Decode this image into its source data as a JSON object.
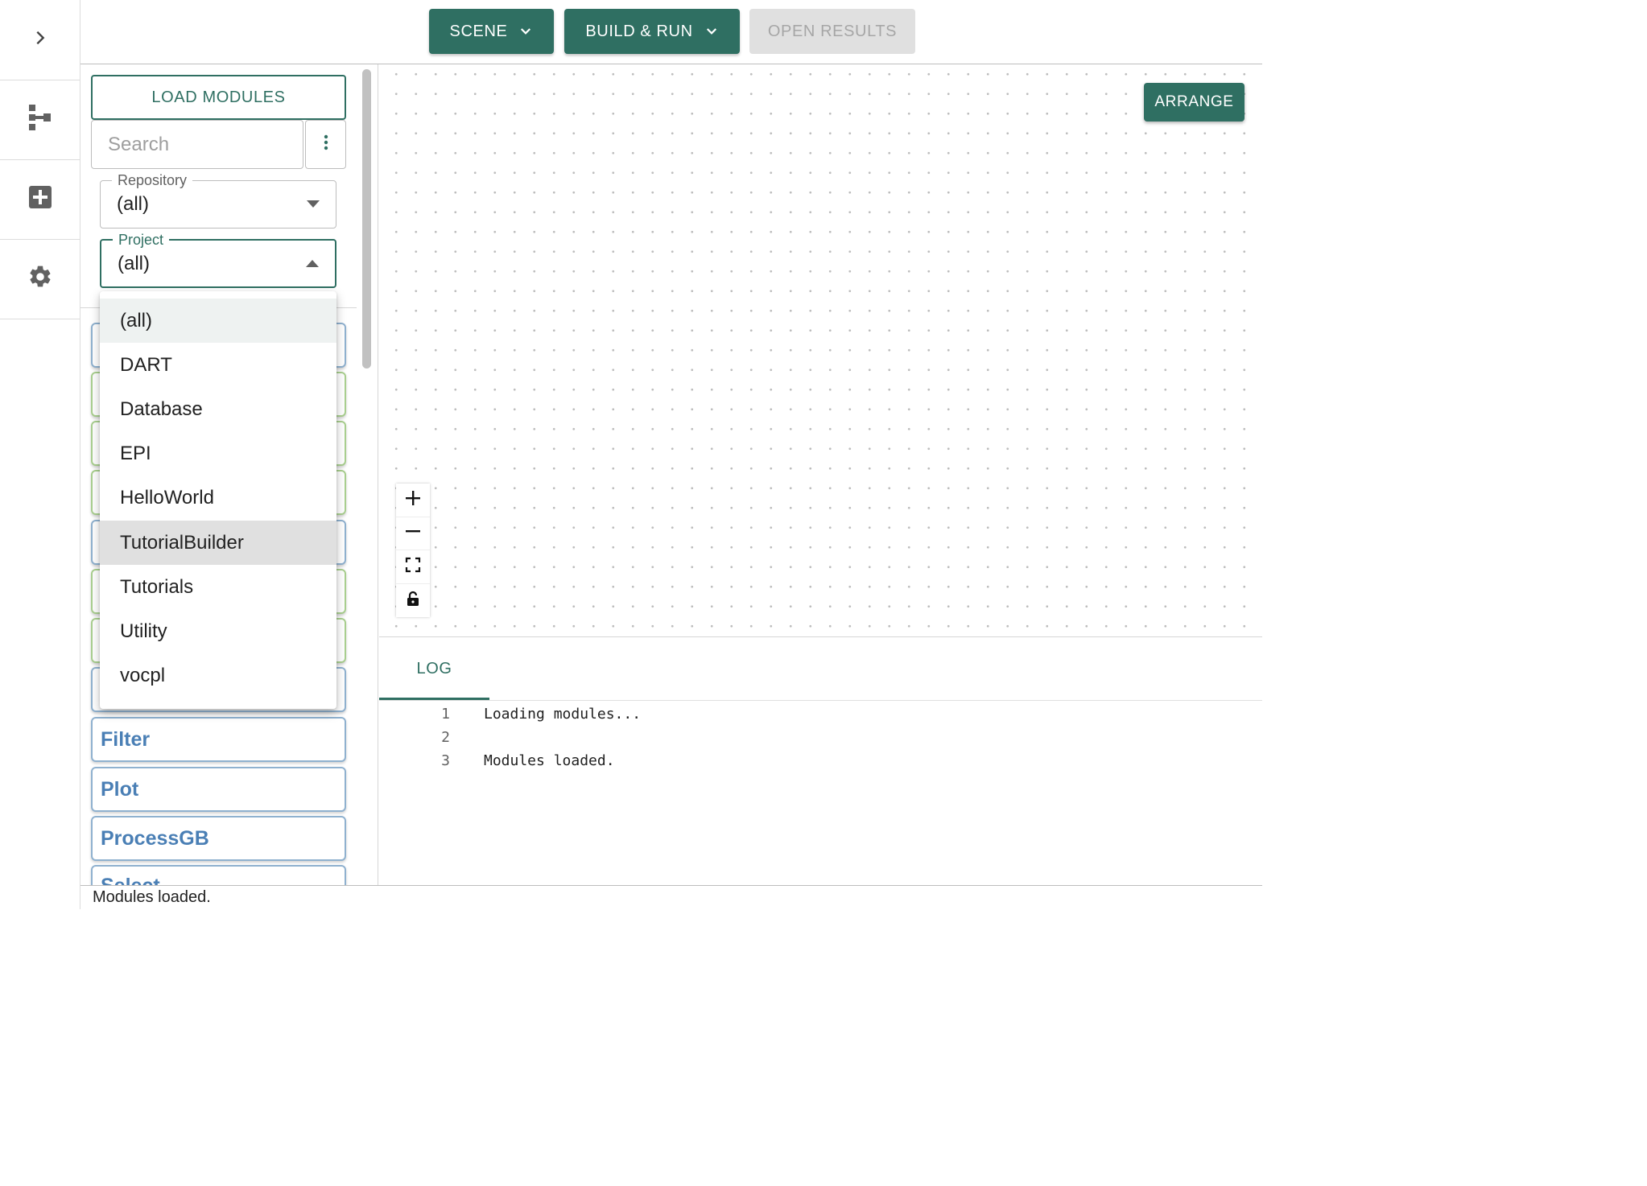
{
  "rail": {
    "icons": [
      "chevron-right-icon",
      "tree-structure-icon",
      "add-box-icon",
      "gear-icon"
    ]
  },
  "toolbar": {
    "scene_label": "SCENE",
    "build_run_label": "BUILD & RUN",
    "open_results_label": "OPEN RESULTS"
  },
  "modules_panel": {
    "load_modules_label": "LOAD MODULES",
    "search": {
      "placeholder": "Search",
      "value": ""
    },
    "repository": {
      "label": "Repository",
      "value": "(all)"
    },
    "project": {
      "label": "Project",
      "value": "(all)",
      "open": true
    },
    "visible_modules": [
      "Filter",
      "Plot",
      "ProcessGB",
      "Select"
    ]
  },
  "project_dropdown": {
    "options": [
      "(all)",
      "DART",
      "Database",
      "EPI",
      "HelloWorld",
      "TutorialBuilder",
      "Tutorials",
      "Utility",
      "vocpl"
    ],
    "selected": "(all)",
    "highlighted": "TutorialBuilder"
  },
  "canvas": {
    "arrange_label": "ARRANGE",
    "controls": [
      "zoom-in-icon",
      "zoom-out-icon",
      "fit-view-icon",
      "lock-icon"
    ]
  },
  "log": {
    "tab_label": "LOG",
    "lines": [
      {
        "num": "1",
        "text": "Loading modules..."
      },
      {
        "num": "2",
        "text": ""
      },
      {
        "num": "3",
        "text": "Modules loaded."
      }
    ]
  },
  "status": {
    "text": "Modules loaded."
  },
  "colors": {
    "accent": "#2f6f62",
    "module_blue": "#4a7fb5",
    "module_green_border": "#a9cf8f"
  }
}
